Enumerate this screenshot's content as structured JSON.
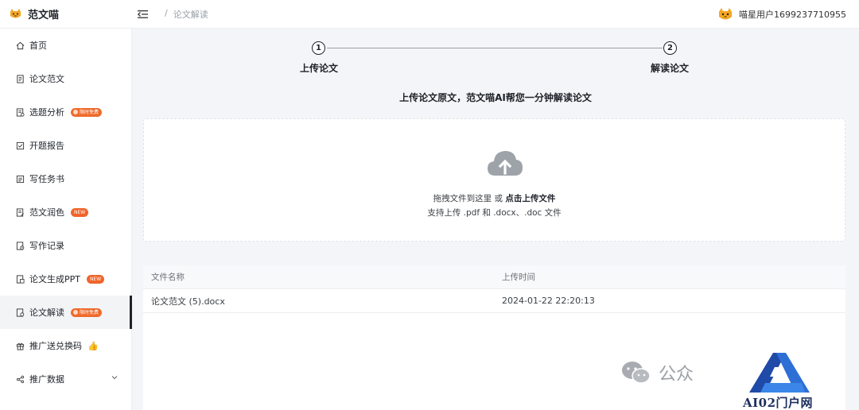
{
  "app": {
    "name": "范文喵"
  },
  "header": {
    "breadcrumb_sep": "/",
    "breadcrumb_current": "论文解读",
    "username": "喵星用户1699237710955"
  },
  "sidebar": {
    "items": [
      {
        "label": "首页",
        "icon": "home-icon"
      },
      {
        "label": "论文范文",
        "icon": "document-icon"
      },
      {
        "label": "选题分析",
        "icon": "topic-analysis-icon",
        "badge": "限时免费"
      },
      {
        "label": "开题报告",
        "icon": "report-icon"
      },
      {
        "label": "写任务书",
        "icon": "task-book-icon"
      },
      {
        "label": "范文润色",
        "icon": "polish-icon",
        "badge": "NEW"
      },
      {
        "label": "写作记录",
        "icon": "history-icon"
      },
      {
        "label": "论文生成PPT",
        "icon": "ppt-icon",
        "badge": "NEW"
      },
      {
        "label": "论文解读",
        "icon": "interpret-icon",
        "badge": "限时免费",
        "active": true
      },
      {
        "label": "推广送兑换码",
        "icon": "gift-icon"
      },
      {
        "label": "推广数据",
        "icon": "share-icon"
      }
    ]
  },
  "steps": [
    {
      "number": "1",
      "label": "上传论文"
    },
    {
      "number": "2",
      "label": "解读论文"
    }
  ],
  "intro": "上传论文原文，范文喵AI帮您一分钟解读论文",
  "upload": {
    "line1_prefix": "拖拽文件到这里 或 ",
    "line1_link": "点击上传文件",
    "line2": "支持上传 .pdf 和 .docx、.doc 文件"
  },
  "table": {
    "columns": [
      "文件名称",
      "上传时间"
    ],
    "rows": [
      {
        "name": "论文范文 (5).docx",
        "time": "2024-01-22 22:20:13"
      }
    ]
  },
  "watermark": {
    "wechat_text": "公众",
    "site_text": "AI02门户网"
  },
  "colors": {
    "accent_orange": "#f0642a",
    "text_dark": "#1f2329",
    "bg": "#f3f5f8"
  }
}
